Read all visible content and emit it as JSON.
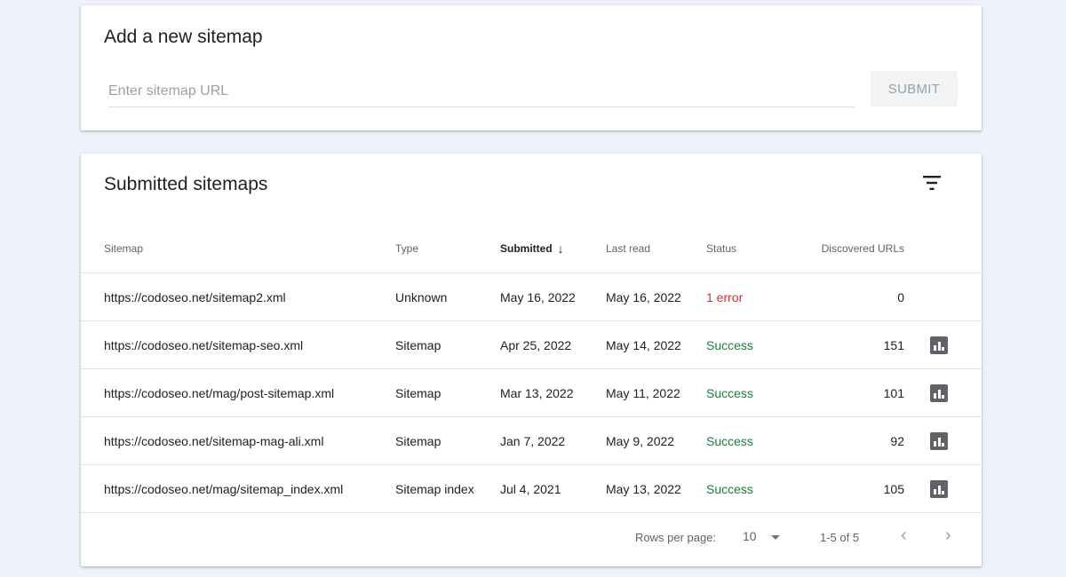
{
  "add_sitemap": {
    "title": "Add a new sitemap",
    "input_placeholder": "Enter sitemap URL",
    "input_value": "",
    "submit_label": "SUBMIT"
  },
  "submitted": {
    "title": "Submitted sitemaps",
    "columns": {
      "sitemap": "Sitemap",
      "type": "Type",
      "submitted": "Submitted",
      "submitted_arrow": "↓",
      "last_read": "Last read",
      "status": "Status",
      "discovered": "Discovered URLs"
    },
    "rows": [
      {
        "sitemap": "https://codoseo.net/sitemap2.xml",
        "type": "Unknown",
        "submitted": "May 16, 2022",
        "last_read": "May 16, 2022",
        "status": "1 error",
        "status_kind": "error",
        "urls": "0",
        "has_report": false
      },
      {
        "sitemap": "https://codoseo.net/sitemap-seo.xml",
        "type": "Sitemap",
        "submitted": "Apr 25, 2022",
        "last_read": "May 14, 2022",
        "status": "Success",
        "status_kind": "success",
        "urls": "151",
        "has_report": true
      },
      {
        "sitemap": "https://codoseo.net/mag/post-sitemap.xml",
        "type": "Sitemap",
        "submitted": "Mar 13, 2022",
        "last_read": "May 11, 2022",
        "status": "Success",
        "status_kind": "success",
        "urls": "101",
        "has_report": true
      },
      {
        "sitemap": "https://codoseo.net/sitemap-mag-ali.xml",
        "type": "Sitemap",
        "submitted": "Jan 7, 2022",
        "last_read": "May 9, 2022",
        "status": "Success",
        "status_kind": "success",
        "urls": "92",
        "has_report": true
      },
      {
        "sitemap": "https://codoseo.net/mag/sitemap_index.xml",
        "type": "Sitemap index",
        "submitted": "Jul 4, 2021",
        "last_read": "May 13, 2022",
        "status": "Success",
        "status_kind": "success",
        "urls": "105",
        "has_report": true
      }
    ],
    "footer": {
      "rows_per_page_label": "Rows per page:",
      "rows_per_page_value": "10",
      "range": "1-5 of 5",
      "prev": "‹",
      "next": "›"
    }
  },
  "icons": {
    "filter": "filter-icon",
    "report": "bar-chart-icon"
  },
  "colors": {
    "background": "#eef2fa",
    "error": "#d93025",
    "success": "#188038",
    "icon": "#5f6368"
  }
}
